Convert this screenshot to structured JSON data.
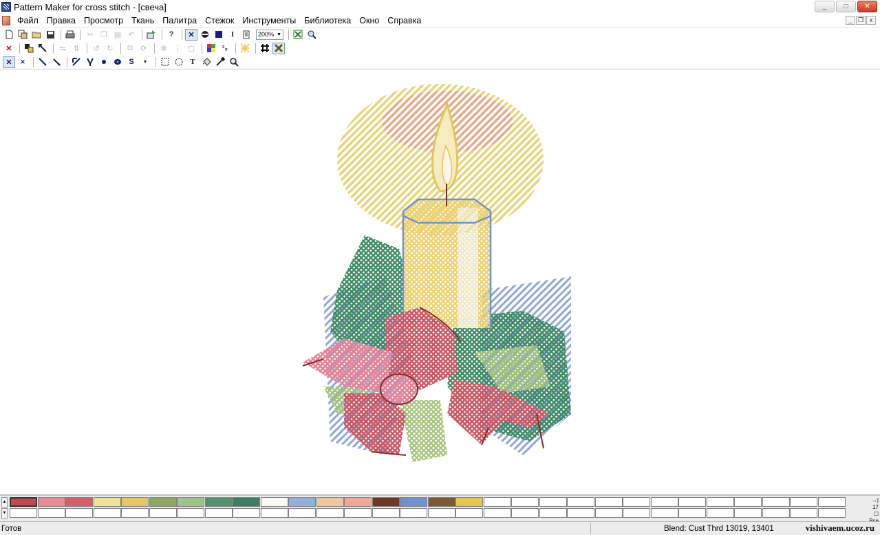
{
  "window": {
    "title": "Pattern Maker for cross stitch - [свеча]",
    "controls": {
      "minimize": "_",
      "maximize": "□",
      "close": "✕"
    },
    "mdi_controls": {
      "minimize": "_",
      "restore": "❐",
      "close": "x"
    }
  },
  "menu": {
    "items": [
      "Файл",
      "Правка",
      "Просмотр",
      "Ткань",
      "Палитра",
      "Стежок",
      "Инструменты",
      "Библиотека",
      "Окно",
      "Справка"
    ]
  },
  "toolbar": {
    "zoom": "200%",
    "row1_icons": [
      "new-file-icon",
      "new-window-icon",
      "open-folder-icon",
      "save-icon",
      "print-icon",
      "cut-icon",
      "copy-icon",
      "paste-icon",
      "undo-icon",
      "import-image-icon",
      "help-icon",
      "full-cross-view-icon",
      "fill-view-icon",
      "symbol-view-icon",
      "cursor-text-icon",
      "page-view-icon",
      "zoom-fit-icon",
      "zoom-area-icon"
    ],
    "row2_icons": [
      "delete-icon",
      "select-color-icon",
      "replace-color-icon",
      "flip-horizontal-icon",
      "flip-vertical-icon",
      "rotate-left-icon",
      "rotate-right-icon",
      "mirror-icon",
      "rotate-icon",
      "snowflake-icon",
      "split-icon",
      "frame-icon",
      "color-palette-icon",
      "superscript-icon",
      "pattern-grid-icon",
      "grid-icon",
      "cross-grid-icon"
    ],
    "row3_icons": [
      "full-stitch-icon",
      "half-stitch-icon",
      "quarter-stitch-icon",
      "three-quarter-stitch-icon",
      "backstitch-icon",
      "long-stitch-icon",
      "french-knot-icon",
      "bead-icon",
      "special-stitch-icon",
      "rect-select-icon",
      "lasso-select-icon",
      "text-tool-icon",
      "fill-bucket-icon",
      "eyedropper-icon",
      "magnifier-icon"
    ]
  },
  "palette": {
    "colors": [
      "#c24a4e",
      "#e88a96",
      "#d45f6c",
      "#efe39a",
      "#e5c76a",
      "#8ea664",
      "#9dc48c",
      "#55916f",
      "#3d7d61",
      "#fbfbf4",
      "#93b0da",
      "#f0c8a0",
      "#eeaa96",
      "#6e3624",
      "#6f93cf",
      "#7a5b35",
      "#e6c653"
    ],
    "empty_slots_row1": 13,
    "empty_slots_row2": 30,
    "page_number": "17",
    "show_all_label": "Все"
  },
  "status": {
    "ready": "Готов",
    "blend": "Blend: Cust Thrd 13019, 13401",
    "watermark": "vishivaem.ucoz.ru"
  }
}
